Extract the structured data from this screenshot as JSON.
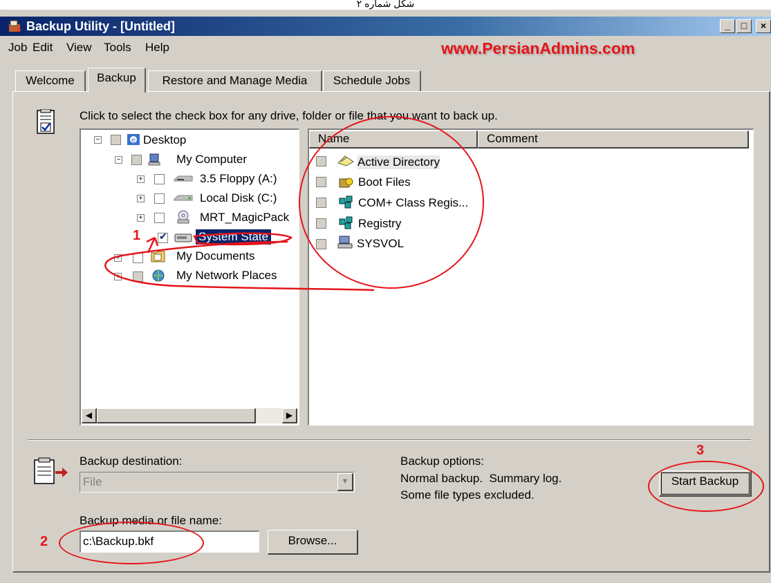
{
  "caption": "شکل شماره ۲",
  "window": {
    "title": "Backup Utility - [Untitled]",
    "controls": [
      "_",
      "□",
      "×"
    ]
  },
  "menu": [
    {
      "label": "Job"
    },
    {
      "label": "Edit"
    },
    {
      "label": "View"
    },
    {
      "label": "Tools"
    },
    {
      "label": "Help"
    }
  ],
  "watermark": "www.PersianAdmins.com",
  "tabs": [
    {
      "label": "Welcome"
    },
    {
      "label": "Backup",
      "active": true
    },
    {
      "label": "Restore and Manage Media"
    },
    {
      "label": "Schedule Jobs"
    }
  ],
  "instruction": "Click to select the check box for any drive, folder or file that you want to back up.",
  "tree": [
    {
      "label": "Desktop"
    },
    {
      "label": "My Computer"
    },
    {
      "label": "3.5 Floppy (A:)"
    },
    {
      "label": "Local Disk (C:)"
    },
    {
      "label": "MRT_MagicPack"
    },
    {
      "label": "System State",
      "checked": true,
      "selected": true
    },
    {
      "label": "My Documents"
    },
    {
      "label": "My Network Places"
    }
  ],
  "list": {
    "columns": [
      "Name",
      "Comment"
    ],
    "items": [
      {
        "name": "Active Directory",
        "icon": "active-directory-icon"
      },
      {
        "name": "Boot Files",
        "icon": "boot-files-icon"
      },
      {
        "name": "COM+ Class Regis...",
        "icon": "com-class-icon"
      },
      {
        "name": "Registry",
        "icon": "registry-icon"
      },
      {
        "name": "SYSVOL",
        "icon": "sysvol-icon"
      }
    ]
  },
  "destination": {
    "label": "Backup destination:",
    "value": "File"
  },
  "media": {
    "label": "Backup media or file name:",
    "value": "c:\\Backup.bkf",
    "browse": "Browse..."
  },
  "options": {
    "label": "Backup options:",
    "line1": "Normal backup.  Summary log.",
    "line2": "Some file types excluded."
  },
  "start_button": "Start Backup",
  "annotations": [
    "1",
    "2",
    "3"
  ],
  "colors": {
    "titlebar": "#0a246a",
    "annotation": "#e5141b",
    "selection": "#0a246a"
  }
}
